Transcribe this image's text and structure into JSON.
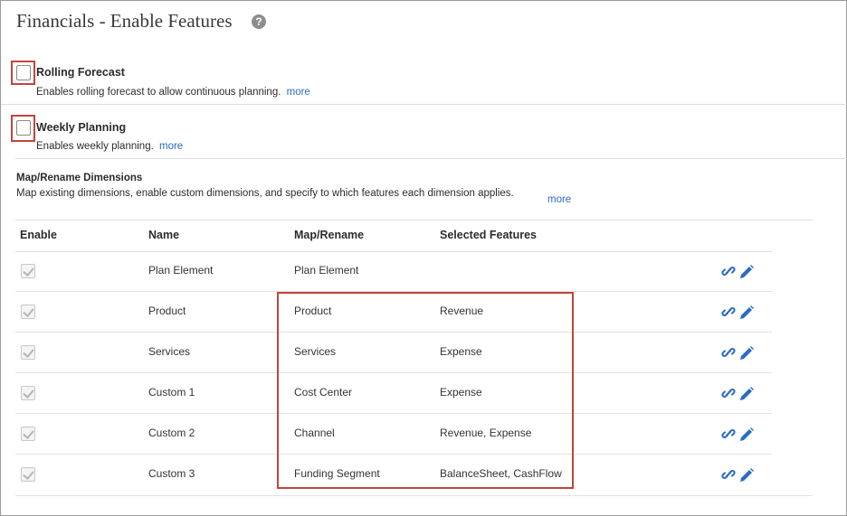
{
  "page": {
    "title": "Financials - Enable Features",
    "help_icon": "?"
  },
  "features": [
    {
      "title": "Rolling Forecast",
      "description": "Enables rolling forecast to allow continuous planning.",
      "more": "more",
      "checked": false
    },
    {
      "title": "Weekly Planning",
      "description": "Enables weekly planning.",
      "more": "more",
      "checked": false
    }
  ],
  "dimensions": {
    "title": "Map/Rename Dimensions",
    "description": "Map existing dimensions, enable custom dimensions, and specify to which features each dimension applies.",
    "more": "more",
    "columns": {
      "enable": "Enable",
      "name": "Name",
      "map": "Map/Rename",
      "features": "Selected Features"
    },
    "rows": [
      {
        "enabled": true,
        "name": "Plan Element",
        "map": "Plan Element",
        "features": ""
      },
      {
        "enabled": true,
        "name": "Product",
        "map": "Product",
        "features": "Revenue"
      },
      {
        "enabled": true,
        "name": "Services",
        "map": "Services",
        "features": "Expense"
      },
      {
        "enabled": true,
        "name": "Custom 1",
        "map": "Cost Center",
        "features": "Expense"
      },
      {
        "enabled": true,
        "name": "Custom 2",
        "map": "Channel",
        "features": "Revenue, Expense"
      },
      {
        "enabled": true,
        "name": "Custom 3",
        "map": "Funding Segment",
        "features": "BalanceSheet, CashFlow"
      }
    ]
  },
  "colors": {
    "highlight": "#c0463a",
    "link": "#2b6cc3",
    "icon": "#2b6cc3"
  },
  "icons": {
    "row_actions": [
      "link-icon",
      "edit-pencil-icon"
    ]
  }
}
